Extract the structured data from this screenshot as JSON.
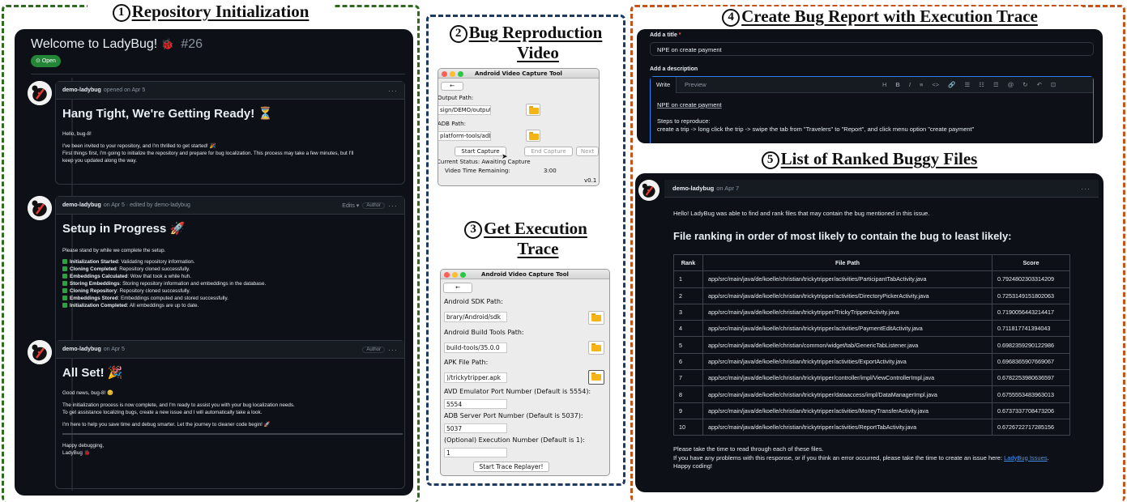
{
  "sections": {
    "s1": {
      "num": "1",
      "title": "Repository Initialization"
    },
    "s2": {
      "num": "2",
      "title_line1": "Bug Reproduction",
      "title_line2": "Video"
    },
    "s3": {
      "num": "3",
      "title_line1": "Get Execution",
      "title_line2": "Trace"
    },
    "s4": {
      "num": "4",
      "title": "Create Bug Report with Execution Trace"
    },
    "s5": {
      "num": "5",
      "title": "List of Ranked Buggy Files"
    }
  },
  "colors": {
    "green_frame": "#2f6b1f",
    "navy_frame": "#1f3a5f",
    "orange_frame": "#c5531a",
    "dark_bg": "#0d1117",
    "open_badge": "#238636"
  },
  "issue": {
    "title": "Welcome to LadyBug!",
    "emoji": "🐞",
    "number": "#26",
    "status": "Open",
    "comments": [
      {
        "author": "demo-ladybug",
        "meta": "opened on Apr 5",
        "heading": "Hang Tight, We're Getting Ready! ⏳",
        "p1": "Hello, bug-8!",
        "p2": "I've been invited to your repository, and I'm thrilled to get started! 🎉",
        "p3": "First things first, I'm going to initialize the repository and prepare for bug localization. This process may take a few minutes, but I'll",
        "p4": "keep you updated along the way."
      },
      {
        "author": "demo-ladybug",
        "meta": "on Apr 5 · edited by demo-ladybug",
        "edits": "Edits ▾",
        "role": "Author",
        "heading": "Setup in Progress 🚀",
        "intro": "Please stand by while we complete the setup.",
        "steps": [
          {
            "label": "Initialization Started",
            "text": ": Validating repository information."
          },
          {
            "label": "Cloning Completed",
            "text": ": Repository cloned successfully."
          },
          {
            "label": "Embeddings Calculated",
            "text": ": Wow that took a while huh."
          },
          {
            "label": "Storing Embeddings",
            "text": ": Storing repository information and embeddings in the database."
          },
          {
            "label": "Cloning Repository",
            "text": ": Repository cloned successfully."
          },
          {
            "label": "Embeddings Stored",
            "text": ": Embeddings computed and stored successfully."
          },
          {
            "label": "Initialization Completed",
            "text": ": All embeddings are up to date."
          }
        ]
      },
      {
        "author": "demo-ladybug",
        "meta": "on Apr 5",
        "role": "Author",
        "heading": "All Set! 🎉",
        "p1": "Good news, bug-8! 😊",
        "p2": "The initialization process is now complete, and I'm ready to assist you with your bug localization needs.",
        "p3": "To get assistance localizing bugs, create a new issue and I will automatically take a look.",
        "p4": "I'm here to help you save time and debug smarter. Let the journey to cleaner code begin! 🚀",
        "sign1": "Happy debugging,",
        "sign2": "LadyBug 🐞"
      }
    ]
  },
  "video_tool": {
    "title": "Android Video Capture Tool",
    "back": "←",
    "output_label": "Output Path:",
    "output_value": "sign/DEMO/output",
    "adb_label": "ADB Path:",
    "adb_value": "platform-tools/adb",
    "start": "Start Capture",
    "end": "End Capture",
    "next": "Next",
    "status": "Current Status: Awaiting Capture",
    "remaining_label": "Video Time Remaining:",
    "remaining_value": "3:00",
    "version": "v0.1"
  },
  "trace_tool": {
    "title": "Android Video Capture Tool",
    "back": "←",
    "sdk_label": "Android SDK Path:",
    "sdk_value": "brary/Android/sdk",
    "build_label": "Android Build Tools Path:",
    "build_value": "build-tools/35.0.0",
    "apk_label": "APK File Path:",
    "apk_value": ")/trickytripper.apk",
    "avd_label": "AVD Emulator Port Number (Default is 5554):",
    "avd_value": "5554",
    "adb_label": "ADB Server Port Number (Default is 5037):",
    "adb_value": "5037",
    "exec_label": "(Optional) Execution Number (Default is 1):",
    "exec_value": "1",
    "button": "Start Trace Replayer!"
  },
  "bug_report": {
    "title_label": "Add a title",
    "required": "*",
    "title_value": "NPE on create payment",
    "desc_label": "Add a description",
    "tab_write": "Write",
    "tab_preview": "Preview",
    "toolbar": [
      "H",
      "B",
      "I",
      "≡",
      "<>",
      "🔗",
      "☰",
      "☷",
      "☲",
      "@",
      "↻",
      "↶",
      "⊡"
    ],
    "line1": "NPE on create payment",
    "line2": "Steps to reproduce:",
    "line3": "create a trip -> long click the trip -> swipe the tab from \"Travelers\" to \"Report\", and click menu option \"create payment\""
  },
  "ranking": {
    "author": "demo-ladybug",
    "meta": "on Apr 7",
    "intro": "Hello! LadyBug was able to find and rank files that may contain the bug mentioned in this issue.",
    "heading": "File ranking in order of most likely to contain the bug to least likely:",
    "columns": [
      "Rank",
      "File Path",
      "Score"
    ],
    "rows": [
      [
        "1",
        "app/src/main/java/de/koelle/christian/trickytripper/activities/ParticipantTabActivity.java",
        "0.7924802303314209"
      ],
      [
        "2",
        "app/src/main/java/de/koelle/christian/trickytripper/activities/DirectoryPickerActivity.java",
        "0.7253149151802063"
      ],
      [
        "3",
        "app/src/main/java/de/koelle/christian/trickytripper/TrickyTripperActivity.java",
        "0.7190056443214417"
      ],
      [
        "4",
        "app/src/main/java/de/koelle/christian/trickytripper/activities/PaymentEditActivity.java",
        "0.711817741394043"
      ],
      [
        "5",
        "app/src/main/java/de/koelle/christian/common/widget/tab/GenericTabListener.java",
        "0.6982359290122986"
      ],
      [
        "6",
        "app/src/main/java/de/koelle/christian/trickytripper/activities/ExportActivity.java",
        "0.6968365907669067"
      ],
      [
        "7",
        "app/src/main/java/de/koelle/christian/trickytripper/controller/impl/ViewControllerImpl.java",
        "0.6782253980636597"
      ],
      [
        "8",
        "app/src/main/java/de/koelle/christian/trickytripper/dataaccess/impl/DataManagerImpl.java",
        "0.6755553483963013"
      ],
      [
        "9",
        "app/src/main/java/de/koelle/christian/trickytripper/activities/MoneyTransferActivity.java",
        "0.6737337708473206"
      ],
      [
        "10",
        "app/src/main/java/de/koelle/christian/trickytripper/activities/ReportTabActivity.java",
        "0.6726722717285156"
      ]
    ],
    "footer1": "Please take the time to read through each of these files.",
    "footer2": "If you have any problems with this response, or if you think an error occurred, please take the time to create an issue here:",
    "footer_link": "LadyBug Issues",
    "footer_end": ".",
    "footer3": "Happy coding!"
  }
}
